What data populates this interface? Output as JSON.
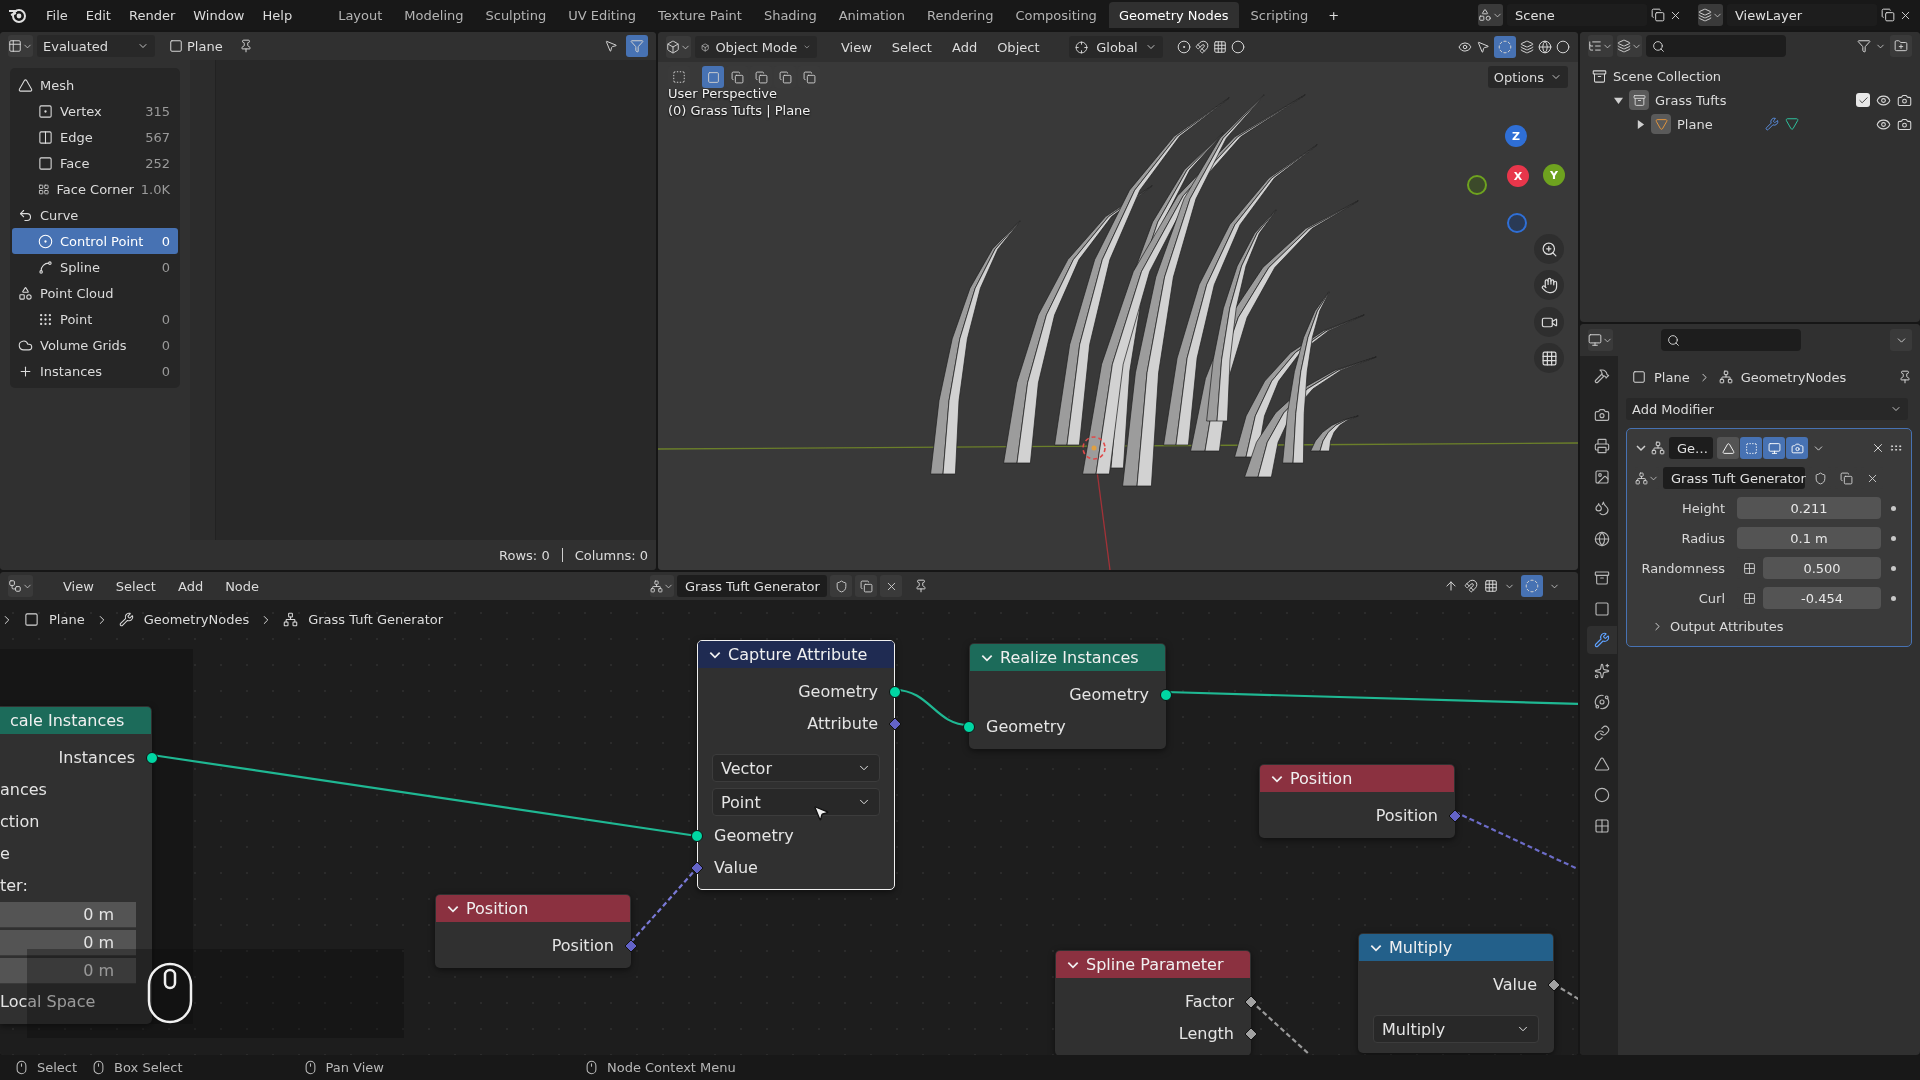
{
  "top_bar": {
    "menus": [
      "File",
      "Edit",
      "Render",
      "Window",
      "Help"
    ],
    "workspaces": [
      {
        "label": "Layout",
        "selected": false
      },
      {
        "label": "Modeling",
        "selected": false
      },
      {
        "label": "Sculpting",
        "selected": false
      },
      {
        "label": "UV Editing",
        "selected": false
      },
      {
        "label": "Texture Paint",
        "selected": false
      },
      {
        "label": "Shading",
        "selected": false
      },
      {
        "label": "Animation",
        "selected": false
      },
      {
        "label": "Rendering",
        "selected": false
      },
      {
        "label": "Compositing",
        "selected": false
      },
      {
        "label": "Geometry Nodes",
        "selected": true
      },
      {
        "label": "Scripting",
        "selected": false
      }
    ],
    "add_workspace": "+",
    "scene": "Scene",
    "view_layer": "ViewLayer"
  },
  "spreadsheet": {
    "evaluation": "Evaluated",
    "object": "Plane",
    "domains": [
      {
        "label": "Mesh",
        "kind": "group",
        "selected": false
      },
      {
        "label": "Vertex",
        "count": "315",
        "kind": "item",
        "selected": false
      },
      {
        "label": "Edge",
        "count": "567",
        "kind": "item",
        "selected": false
      },
      {
        "label": "Face",
        "count": "252",
        "kind": "item",
        "selected": false
      },
      {
        "label": "Face Corner",
        "count": "1.0K",
        "kind": "item",
        "selected": false
      },
      {
        "label": "Curve",
        "kind": "group",
        "selected": false
      },
      {
        "label": "Control Point",
        "count": "0",
        "kind": "item",
        "selected": true
      },
      {
        "label": "Spline",
        "count": "0",
        "kind": "item",
        "selected": false
      },
      {
        "label": "Point Cloud",
        "kind": "group",
        "selected": false
      },
      {
        "label": "Point",
        "count": "0",
        "kind": "item",
        "selected": false
      },
      {
        "label": "Volume Grids",
        "count": "0",
        "kind": "group",
        "selected": false
      },
      {
        "label": "Instances",
        "count": "0",
        "kind": "group",
        "selected": false
      }
    ],
    "rows": "Rows: 0",
    "columns": "Columns: 0"
  },
  "viewport": {
    "mode": "Object Mode",
    "menus": [
      "View",
      "Select",
      "Add",
      "Object"
    ],
    "orientation": "Global",
    "options": "Options",
    "info": [
      "User Perspective",
      "(0) Grass Tufts | Plane"
    ],
    "axes": [
      {
        "label": "Z",
        "color": "#2f6fd6"
      },
      {
        "label": "X",
        "color": "#e8364b"
      },
      {
        "label": "Y",
        "color": "#6ea21f"
      }
    ]
  },
  "outliner": {
    "tree": [
      {
        "label": "Scene Collection",
        "kind": "scene",
        "children": [
          {
            "label": "Grass Tufts",
            "kind": "collection",
            "expanded": true,
            "checked": true,
            "children": [
              {
                "label": "Plane",
                "kind": "object",
                "expanded": false
              }
            ]
          }
        ]
      }
    ]
  },
  "properties": {
    "tabs": [
      {
        "selected": false
      },
      {
        "selected": false
      },
      {
        "selected": false
      },
      {
        "selected": false
      },
      {
        "selected": false
      },
      {
        "selected": false
      },
      {
        "selected": false
      },
      {
        "selected": false
      },
      {
        "selected": true
      },
      {
        "selected": false
      },
      {
        "selected": false
      },
      {
        "selected": false
      },
      {
        "selected": false
      },
      {
        "selected": false
      },
      {
        "selected": false
      }
    ],
    "breadcrumb": [
      "Plane",
      "GeometryNodes"
    ],
    "add_modifier": "Add Modifier",
    "modifier": {
      "name": "Ge…",
      "expanded": true,
      "toggles": [
        {
          "on": false
        },
        {
          "on": true
        },
        {
          "on": true
        },
        {
          "on": true
        }
      ],
      "node_group": "Grass Tuft Generator",
      "inputs": [
        {
          "label": "Height",
          "value": "0.211",
          "kind": "plain"
        },
        {
          "label": "Radius",
          "value": "0.1 m",
          "kind": "plain"
        },
        {
          "label": "Randomness",
          "value": "0.500",
          "kind": "attribute"
        },
        {
          "label": "Curl",
          "value": "-0.454",
          "kind": "attribute"
        }
      ],
      "output_attributes": {
        "label": "Output Attributes",
        "expanded": false
      }
    }
  },
  "node_editor": {
    "menus": [
      "View",
      "Select",
      "Add",
      "Node"
    ],
    "node_group": "Grass Tuft Generator",
    "breadcrumb": [
      "Plane",
      "GeometryNodes",
      "Grass Tuft Generator"
    ],
    "nodes": [
      {
        "title": "cale Instances",
        "kind": "geometry",
        "selected": false,
        "rows": [
          {
            "kind": "output",
            "label": "Instances",
            "socket": {
              "kind": "geometry"
            }
          },
          {
            "kind": "label",
            "label": "ances"
          },
          {
            "kind": "label",
            "label": "ction"
          },
          {
            "kind": "label",
            "label": "e"
          },
          {
            "kind": "label",
            "label": "ter:"
          },
          {
            "kind": "field",
            "value": "0 m"
          },
          {
            "kind": "field",
            "value": "0 m"
          },
          {
            "kind": "field",
            "value": "0 m"
          },
          {
            "kind": "label",
            "label": "Local Space"
          }
        ]
      },
      {
        "title": "Capture Attribute",
        "kind": "attribute",
        "selected": true,
        "expanded": true,
        "rows": [
          {
            "kind": "output",
            "label": "Geometry",
            "socket": {
              "kind": "geometry"
            }
          },
          {
            "kind": "output",
            "label": "Attribute",
            "socket": {
              "kind": "vector"
            }
          },
          {
            "kind": "select",
            "value": "Vector"
          },
          {
            "kind": "select",
            "value": "Point"
          },
          {
            "kind": "input",
            "label": "Geometry",
            "socket": {
              "kind": "geometry"
            }
          },
          {
            "kind": "input",
            "label": "Value",
            "socket": {
              "kind": "vector"
            }
          }
        ]
      },
      {
        "title": "Realize Instances",
        "kind": "geometry",
        "selected": false,
        "expanded": true,
        "rows": [
          {
            "kind": "output",
            "label": "Geometry",
            "socket": {
              "kind": "geometry"
            }
          },
          {
            "kind": "input",
            "label": "Geometry",
            "socket": {
              "kind": "geometry"
            }
          }
        ]
      },
      {
        "title": "Position",
        "kind": "input",
        "selected": false,
        "expanded": true,
        "rows": [
          {
            "kind": "output",
            "label": "Position",
            "socket": {
              "kind": "vector"
            }
          }
        ]
      },
      {
        "title": "Position",
        "kind": "input",
        "selected": false,
        "expanded": true,
        "rows": [
          {
            "kind": "output",
            "label": "Position",
            "socket": {
              "kind": "vector"
            }
          }
        ]
      },
      {
        "title": "Spline Parameter",
        "kind": "input",
        "selected": false,
        "expanded": true,
        "rows": [
          {
            "kind": "output",
            "label": "Factor",
            "socket": {
              "kind": "float"
            }
          },
          {
            "kind": "output",
            "label": "Length",
            "socket": {
              "kind": "float"
            }
          }
        ]
      },
      {
        "title": "Multiply",
        "kind": "converter",
        "selected": false,
        "expanded": true,
        "rows": [
          {
            "kind": "output",
            "label": "Value",
            "socket": {
              "kind": "float"
            }
          },
          {
            "kind": "select",
            "value": "Multiply"
          }
        ]
      }
    ]
  },
  "status_bar": {
    "hints": [
      "Select",
      "Box Select",
      "Pan View",
      "Node Context Menu"
    ]
  }
}
